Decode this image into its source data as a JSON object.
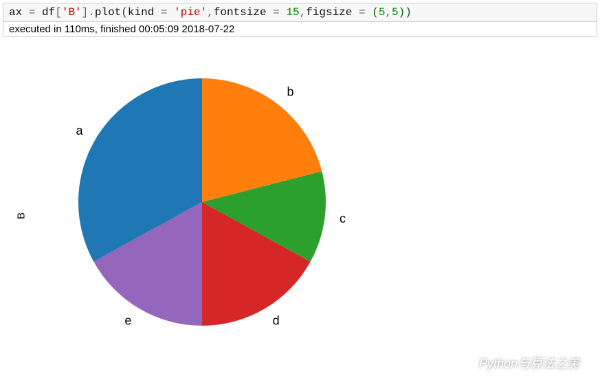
{
  "code": {
    "tokens": [
      {
        "t": "ax ",
        "c": "id"
      },
      {
        "t": "=",
        "c": "op"
      },
      {
        "t": " df",
        "c": "id"
      },
      {
        "t": "[",
        "c": "op"
      },
      {
        "t": "'B'",
        "c": "str"
      },
      {
        "t": "]",
        "c": "op"
      },
      {
        "t": ".",
        "c": "op"
      },
      {
        "t": "plot",
        "c": "fn"
      },
      {
        "t": "(",
        "c": "paren"
      },
      {
        "t": "kind ",
        "c": "arg"
      },
      {
        "t": "=",
        "c": "op"
      },
      {
        "t": " 'pie'",
        "c": "str"
      },
      {
        "t": ",",
        "c": "op"
      },
      {
        "t": "fontsize ",
        "c": "arg"
      },
      {
        "t": "=",
        "c": "op"
      },
      {
        "t": " 15",
        "c": "num"
      },
      {
        "t": ",",
        "c": "op"
      },
      {
        "t": "figsize ",
        "c": "arg"
      },
      {
        "t": "=",
        "c": "op"
      },
      {
        "t": " (",
        "c": "paren"
      },
      {
        "t": "5",
        "c": "num"
      },
      {
        "t": ",",
        "c": "op"
      },
      {
        "t": "5",
        "c": "num"
      },
      {
        "t": ")",
        "c": "paren"
      },
      {
        "t": ")",
        "c": "paren"
      }
    ]
  },
  "exec_banner": "executed in 110ms, finished 00:05:09 2018-07-22",
  "ylabel": "B",
  "watermark": "Python与算法之美",
  "chart_data": {
    "type": "pie",
    "title": "",
    "ylabel": "B",
    "series": [
      {
        "name": "a",
        "value": 33,
        "color": "#1f77b4"
      },
      {
        "name": "e",
        "value": 17,
        "color": "#9467bd"
      },
      {
        "name": "d",
        "value": 17,
        "color": "#d62728"
      },
      {
        "name": "c",
        "value": 12,
        "color": "#2ca02c"
      },
      {
        "name": "b",
        "value": 21,
        "color": "#ff7f0e"
      }
    ]
  }
}
